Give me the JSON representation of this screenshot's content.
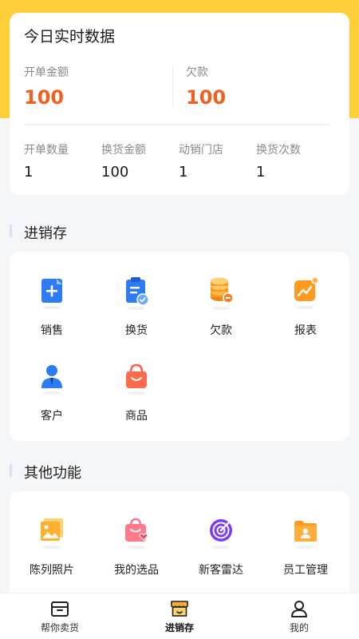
{
  "stats": {
    "title": "今日实时数据",
    "amount_label": "开单金额",
    "amount_value": "100",
    "debt_label": "欠款",
    "debt_value": "100",
    "small": [
      {
        "label": "开单数量",
        "value": "1"
      },
      {
        "label": "换货金额",
        "value": "100"
      },
      {
        "label": "动销门店",
        "value": "1"
      },
      {
        "label": "换货次数",
        "value": "1"
      }
    ]
  },
  "inventory": {
    "title": "进销存",
    "items": [
      {
        "label": "销售",
        "icon": "sales-document-icon"
      },
      {
        "label": "换货",
        "icon": "exchange-clipboard-icon"
      },
      {
        "label": "欠款",
        "icon": "coins-debt-icon"
      },
      {
        "label": "报表",
        "icon": "report-chart-icon"
      },
      {
        "label": "客户",
        "icon": "customer-person-icon"
      },
      {
        "label": "商品",
        "icon": "shopping-bag-icon"
      }
    ]
  },
  "other": {
    "title": "其他功能",
    "items": [
      {
        "label": "陈列照片",
        "icon": "photo-gallery-icon"
      },
      {
        "label": "我的选品",
        "icon": "favorite-bag-icon"
      },
      {
        "label": "新客雷达",
        "icon": "radar-target-icon"
      },
      {
        "label": "员工管理",
        "icon": "staff-folder-icon"
      }
    ]
  },
  "nav": {
    "items": [
      {
        "label": "帮你卖货",
        "icon": "store-box-icon"
      },
      {
        "label": "进销存",
        "icon": "shop-awning-icon"
      },
      {
        "label": "我的",
        "icon": "user-profile-icon"
      }
    ],
    "active_index": 1
  },
  "colors": {
    "header_yellow": "#ffcf3a",
    "accent_orange": "#f0601e",
    "icon_blue": "#2d7cf6",
    "icon_orange": "#ff9a1f",
    "icon_red": "#ff5a4a",
    "icon_purple": "#7b3cf0"
  }
}
